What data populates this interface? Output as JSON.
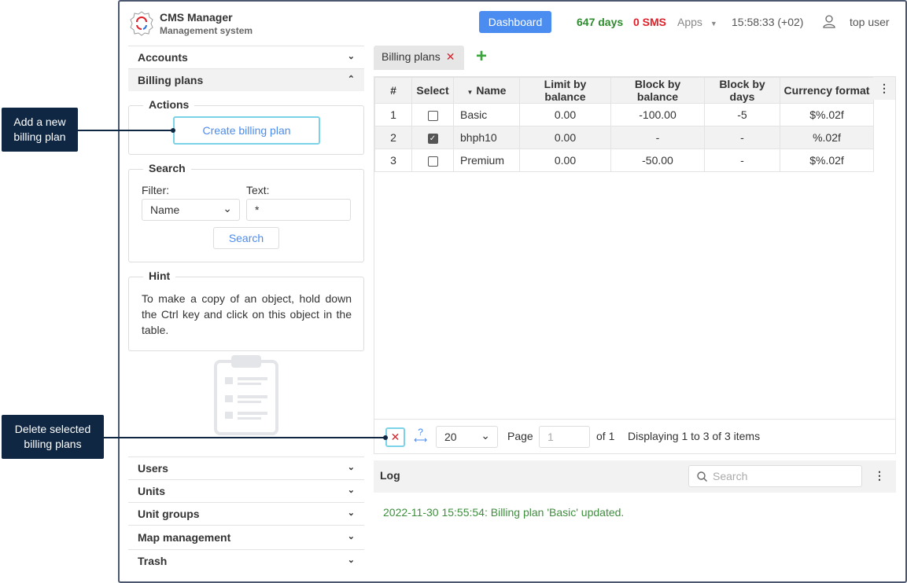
{
  "header": {
    "title": "CMS Manager",
    "subtitle": "Management system",
    "dashboard": "Dashboard",
    "days": "647 days",
    "sms": "0 SMS",
    "apps": "Apps",
    "time": "15:58:33 (+02)",
    "user": "top user"
  },
  "sidebar": {
    "accounts": "Accounts",
    "billing_plans": "Billing plans",
    "actions_legend": "Actions",
    "create_button": "Create billing plan",
    "search_legend": "Search",
    "filter_label": "Filter:",
    "text_label": "Text:",
    "filter_value": "Name",
    "text_value": "*",
    "search_button": "Search",
    "hint_legend": "Hint",
    "hint_text": "To make a copy of an object, hold down the Ctrl key and click on this object in the table.",
    "bottom_items": [
      "Users",
      "Units",
      "Unit groups",
      "Map management",
      "Trash"
    ]
  },
  "tabs": [
    {
      "label": "Billing plans"
    }
  ],
  "table": {
    "headers": [
      "#",
      "Select",
      "Name",
      "Limit by balance",
      "Block by balance",
      "Block by days",
      "Currency format"
    ],
    "rows": [
      [
        "1",
        "",
        "Basic",
        "0.00",
        "-100.00",
        "-5",
        "$%.02f"
      ],
      [
        "2",
        "",
        "bhph10",
        "0.00",
        "-",
        "-",
        "%.02f"
      ],
      [
        "3",
        "",
        "Premium",
        "0.00",
        "-50.00",
        "-",
        "$%.02f"
      ]
    ],
    "checked": [
      false,
      true,
      false
    ]
  },
  "pager": {
    "page_size": "20",
    "page_label": "Page",
    "page_value": "1",
    "of": "of 1",
    "display": "Displaying 1 to 3 of 3 items"
  },
  "log": {
    "title": "Log",
    "search_placeholder": "Search",
    "entries": [
      "2022-11-30 15:55:54: Billing plan 'Basic' updated."
    ]
  },
  "callouts": {
    "create": "Add a new billing plan",
    "delete": "Delete selected billing plans"
  },
  "colors": {
    "accent": "#4b8cf0",
    "days": "#2e8b2e",
    "sms": "#e0202a",
    "callout": "#0f2742"
  }
}
